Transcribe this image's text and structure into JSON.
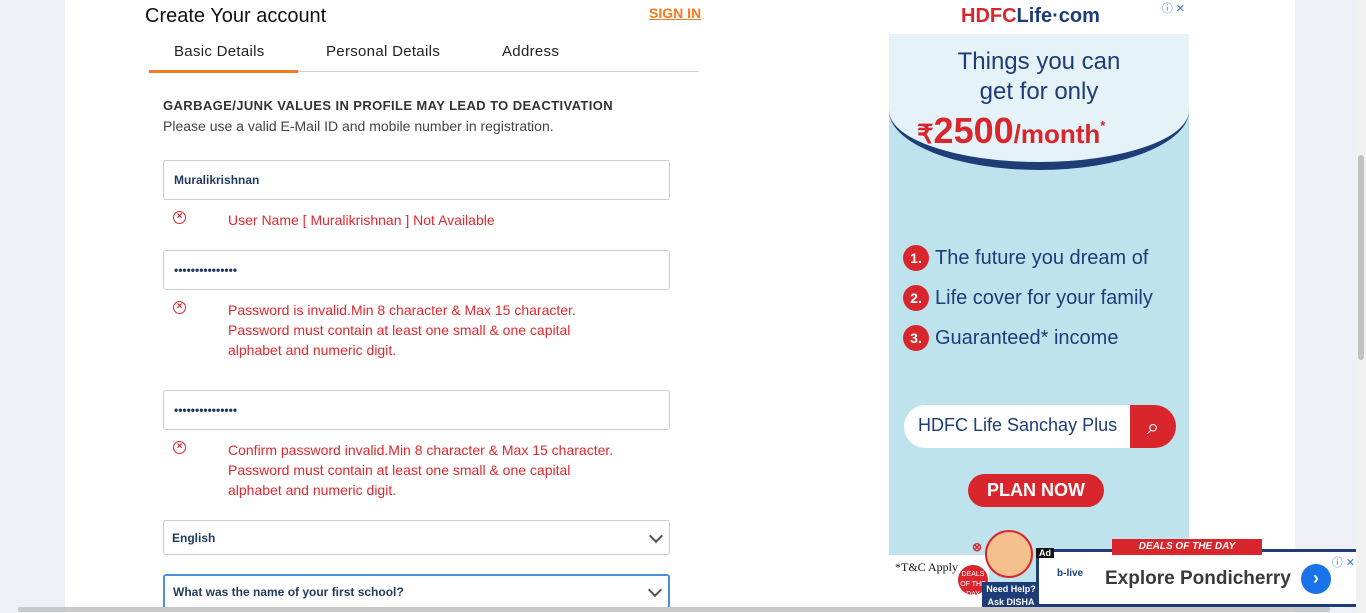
{
  "form": {
    "title": "Create Your account",
    "signin": "SIGN IN",
    "tabs": [
      {
        "label": "Basic Details",
        "active": true
      },
      {
        "label": "Personal Details",
        "active": false
      },
      {
        "label": "Address",
        "active": false
      }
    ],
    "notice": "GARBAGE/JUNK VALUES IN PROFILE MAY LEAD TO DEACTIVATION",
    "subnotice": "Please use a valid E-Mail ID and mobile number in registration.",
    "username": {
      "value": "Muralikrishnan",
      "error": "User Name [ Muralikrishnan ] Not Available"
    },
    "password": {
      "value": "•••••••••••••••",
      "error": [
        "Password is invalid.Min 8 character & Max 15 character.",
        "Password must contain at least one small & one capital",
        "alphabet and numeric digit."
      ]
    },
    "confirm_password": {
      "value": "•••••••••••••••",
      "error": [
        "Confirm password invalid.Min 8 character & Max 15 character.",
        "Password must contain at least one small & one capital",
        "alphabet and numeric digit."
      ]
    },
    "language_select": {
      "value": "English"
    },
    "security_question": {
      "value": "What was the name of your first school?"
    },
    "error_icon": "x-circle-icon"
  },
  "ad": {
    "logo_main": "HDFC",
    "logo_sub": "Life",
    "logo_tail": "·com",
    "headline1": "Things you can",
    "headline2": "get for only",
    "price_symbol": "₹",
    "price": "2500",
    "price_unit": "/month",
    "price_mark": "*",
    "points": [
      {
        "num": "1.",
        "text": "The future you dream of"
      },
      {
        "num": "2.",
        "text": "Life cover for your family"
      },
      {
        "num": "3.",
        "text": "Guaranteed* income"
      }
    ],
    "search_text": "HDFC Life Sanchay Plus",
    "cta": "PLAN NOW",
    "tnc": "*T&C Apply"
  },
  "disha": {
    "badge": "DEALS OF THE DAY",
    "label_line1": "Need Help?",
    "label_line2": "Ask DISHA"
  },
  "bottom_ad": {
    "tag": "Ad",
    "ribbon": "DEALS OF THE DAY",
    "logo": "b-live",
    "text": "Explore Pondicherry"
  },
  "colors": {
    "accent": "#f47920",
    "error": "#e0282e",
    "brand_red": "#d8262c",
    "brand_blue": "#1d3c78"
  }
}
